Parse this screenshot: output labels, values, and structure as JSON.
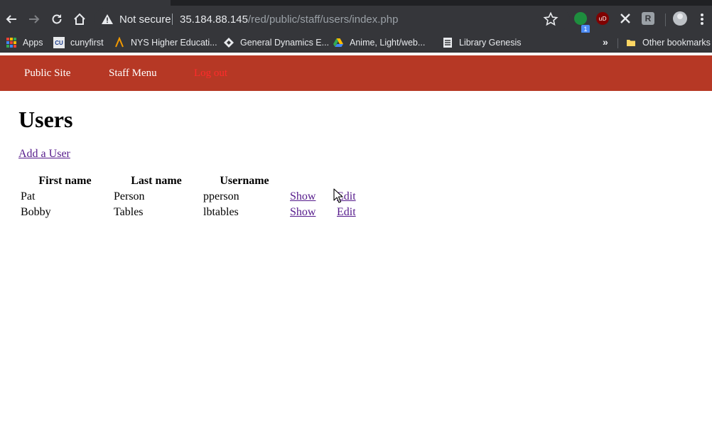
{
  "browser": {
    "address": {
      "security_label": "Not secure",
      "url_host": "35.184.88.145",
      "url_path": "/red/public/staff/users/index.php"
    },
    "bookmarks": [
      {
        "label": "Apps",
        "icon": "apps-grid-icon"
      },
      {
        "label": "cunyfirst",
        "icon": "cunyfirst-icon"
      },
      {
        "label": "NYS Higher Educati...",
        "icon": "nys-hesc-icon"
      },
      {
        "label": "General Dynamics E...",
        "icon": "general-dynamics-icon"
      },
      {
        "label": "Anime, Light/web...",
        "icon": "google-drive-icon"
      },
      {
        "label": "Library Genesis",
        "icon": "library-genesis-icon"
      }
    ],
    "other_bookmarks": "Other bookmarks",
    "extension_badge": "1",
    "colors": {
      "chrome_bg": "#35363a",
      "tabstrip_bg": "#202124",
      "nav_bar": "#b63825",
      "logout_link": "#ff2b2b",
      "link_visited": "#551a8b"
    }
  },
  "site_nav": {
    "public_site": "Public Site",
    "staff_menu": "Staff Menu",
    "log_out": "Log out"
  },
  "page": {
    "title": "Users",
    "add_user": "Add a User",
    "table": {
      "headers": [
        "First name",
        "Last name",
        "Username",
        "",
        ""
      ],
      "rows": [
        {
          "first": "Pat",
          "last": "Person",
          "username": "pperson",
          "show": "Show",
          "edit": "Edit"
        },
        {
          "first": "Bobby",
          "last": "Tables",
          "username": "lbtables",
          "show": "Show",
          "edit": "Edit"
        }
      ]
    }
  }
}
